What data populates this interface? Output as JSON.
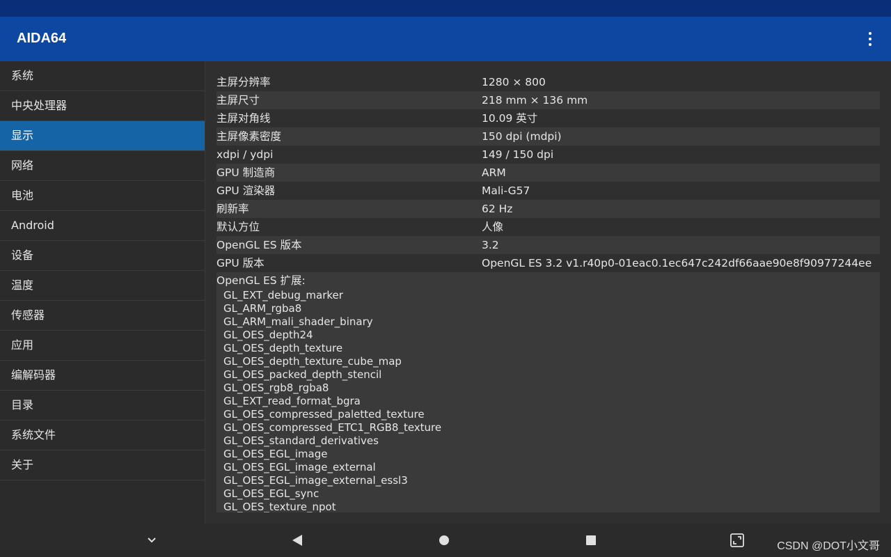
{
  "app": {
    "title": "AIDA64"
  },
  "sidebar": {
    "items": [
      {
        "label": "系统"
      },
      {
        "label": "中央处理器"
      },
      {
        "label": "显示"
      },
      {
        "label": "网络"
      },
      {
        "label": "电池"
      },
      {
        "label": "Android"
      },
      {
        "label": "设备"
      },
      {
        "label": "温度"
      },
      {
        "label": "传感器"
      },
      {
        "label": "应用"
      },
      {
        "label": "编解码器"
      },
      {
        "label": "目录"
      },
      {
        "label": "系统文件"
      },
      {
        "label": "关于"
      }
    ],
    "active_index": 2
  },
  "display": {
    "rows": [
      {
        "key": "主屏分辨率",
        "value": "1280 × 800"
      },
      {
        "key": "主屏尺寸",
        "value": "218 mm × 136 mm"
      },
      {
        "key": "主屏对角线",
        "value": "10.09 英寸"
      },
      {
        "key": "主屏像素密度",
        "value": "150 dpi (mdpi)"
      },
      {
        "key": "xdpi / ydpi",
        "value": "149 / 150 dpi"
      },
      {
        "key": "GPU 制造商",
        "value": "ARM"
      },
      {
        "key": "GPU 渲染器",
        "value": "Mali-G57"
      },
      {
        "key": "刷新率",
        "value": "62 Hz"
      },
      {
        "key": "默认方位",
        "value": "人像"
      },
      {
        "key": "OpenGL ES 版本",
        "value": "3.2"
      },
      {
        "key": "GPU 版本",
        "value": "OpenGL ES 3.2 v1.r40p0-01eac0.1ec647c242df66aae90e8f90977244ee"
      }
    ],
    "extensions_title": "OpenGL ES 扩展:",
    "extensions": [
      "GL_EXT_debug_marker",
      "GL_ARM_rgba8",
      "GL_ARM_mali_shader_binary",
      "GL_OES_depth24",
      "GL_OES_depth_texture",
      "GL_OES_depth_texture_cube_map",
      "GL_OES_packed_depth_stencil",
      "GL_OES_rgb8_rgba8",
      "GL_EXT_read_format_bgra",
      "GL_OES_compressed_paletted_texture",
      "GL_OES_compressed_ETC1_RGB8_texture",
      "GL_OES_standard_derivatives",
      "GL_OES_EGL_image",
      "GL_OES_EGL_image_external",
      "GL_OES_EGL_image_external_essl3",
      "GL_OES_EGL_sync",
      "GL_OES_texture_npot"
    ]
  },
  "navbar": {
    "watermark": "CSDN @DOT小文哥",
    "icons": [
      "chevron-down-icon",
      "back-icon",
      "home-icon",
      "recents-icon",
      "fullscreen-icon"
    ]
  },
  "colors": {
    "app_bar": "#0d47a1",
    "status_bar": "#0a2f78",
    "active_item": "#1565a6",
    "background": "#303030"
  }
}
